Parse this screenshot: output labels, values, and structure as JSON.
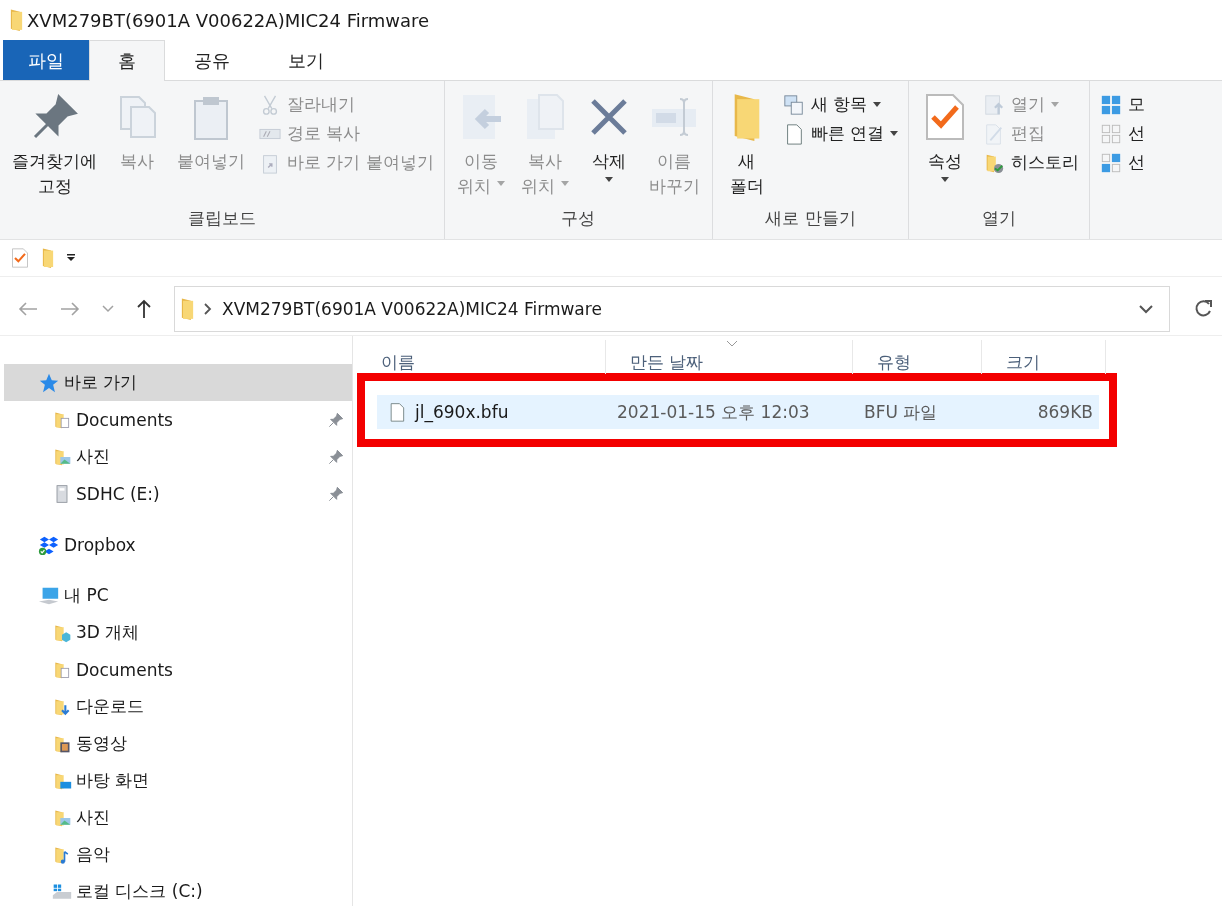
{
  "window": {
    "title": "XVM279BT(6901A V00622A)MIC24 Firmware"
  },
  "tabs": [
    {
      "label": "파일",
      "kind": "file",
      "selected": false
    },
    {
      "label": "홈",
      "kind": "tab",
      "selected": true
    },
    {
      "label": "공유",
      "kind": "tab",
      "selected": false
    },
    {
      "label": "보기",
      "kind": "tab",
      "selected": false
    }
  ],
  "ribbon": {
    "groups": [
      {
        "label": "클립보드",
        "items": [
          {
            "kind": "large",
            "lines": [
              "즐겨찾기에",
              "고정"
            ],
            "disabled": false,
            "dropdown": false
          },
          {
            "kind": "large",
            "lines": [
              "복사"
            ],
            "disabled": true,
            "dropdown": false
          },
          {
            "kind": "large",
            "lines": [
              "붙여넣기"
            ],
            "disabled": true,
            "dropdown": false
          },
          {
            "kind": "small",
            "lines": [
              "잘라내기"
            ],
            "disabled": true,
            "dropdown": false
          },
          {
            "kind": "small",
            "lines": [
              "경로 복사"
            ],
            "disabled": true,
            "dropdown": false
          },
          {
            "kind": "small",
            "lines": [
              "바로 가기 붙여넣기"
            ],
            "disabled": true,
            "dropdown": false
          }
        ]
      },
      {
        "label": "구성",
        "items": [
          {
            "kind": "large",
            "lines": [
              "이동",
              "위치"
            ],
            "disabled": true,
            "dropdown": true
          },
          {
            "kind": "large",
            "lines": [
              "복사",
              "위치"
            ],
            "disabled": true,
            "dropdown": true
          },
          {
            "kind": "large",
            "lines": [
              "삭제"
            ],
            "disabled": false,
            "dropdown": true
          },
          {
            "kind": "large",
            "lines": [
              "이름",
              "바꾸기"
            ],
            "disabled": true,
            "dropdown": false
          }
        ]
      },
      {
        "label": "새로 만들기",
        "items": [
          {
            "kind": "large",
            "lines": [
              "새",
              "폴더"
            ],
            "disabled": false,
            "dropdown": false
          },
          {
            "kind": "small",
            "lines": [
              "새 항목"
            ],
            "disabled": false,
            "dropdown": true
          },
          {
            "kind": "small",
            "lines": [
              "빠른 연결"
            ],
            "disabled": false,
            "dropdown": true
          }
        ]
      },
      {
        "label": "열기",
        "items": [
          {
            "kind": "large",
            "lines": [
              "속성"
            ],
            "disabled": false,
            "dropdown": true
          },
          {
            "kind": "small",
            "lines": [
              "열기"
            ],
            "disabled": true,
            "dropdown": true
          },
          {
            "kind": "small",
            "lines": [
              "편집"
            ],
            "disabled": true,
            "dropdown": false
          },
          {
            "kind": "small",
            "lines": [
              "히스토리"
            ],
            "disabled": false,
            "dropdown": false
          }
        ]
      },
      {
        "items": [
          {
            "kind": "small",
            "lines": [
              "모"
            ],
            "disabled": false,
            "dropdown": false
          },
          {
            "kind": "small",
            "lines": [
              "선"
            ],
            "disabled": false,
            "dropdown": false
          },
          {
            "kind": "small",
            "lines": [
              "선"
            ],
            "disabled": false,
            "dropdown": false
          }
        ]
      }
    ]
  },
  "address": {
    "back_disabled": true,
    "forward_disabled": true,
    "path": "XVM279BT(6901A V00622A)MIC24 Firmware"
  },
  "navigation": [
    {
      "label": "바로 가기",
      "selected": true,
      "children": [
        {
          "label": "Documents",
          "selected": false,
          "pinned": true
        },
        {
          "label": "사진",
          "selected": false,
          "pinned": true
        },
        {
          "label": "SDHC (E:)",
          "selected": false,
          "pinned": true
        }
      ]
    },
    {
      "label": "Dropbox",
      "selected": false
    },
    {
      "label": "내 PC",
      "selected": false,
      "children": [
        {
          "label": "3D 개체",
          "selected": false,
          "pinned": false
        },
        {
          "label": "Documents",
          "selected": false,
          "pinned": false
        },
        {
          "label": "다운로드",
          "selected": false,
          "pinned": false
        },
        {
          "label": "동영상",
          "selected": false,
          "pinned": false
        },
        {
          "label": "바탕 화면",
          "selected": false,
          "pinned": false
        },
        {
          "label": "사진",
          "selected": false,
          "pinned": false
        },
        {
          "label": "음악",
          "selected": false,
          "pinned": false
        },
        {
          "label": "로컬 디스크 (C:)",
          "selected": false,
          "pinned": false
        }
      ]
    }
  ],
  "files": {
    "columns": [
      {
        "label": "이름",
        "sorted": false
      },
      {
        "label": "만든 날짜",
        "sorted": true
      },
      {
        "label": "유형",
        "sorted": false
      },
      {
        "label": "크기",
        "sorted": false
      }
    ],
    "rows": [
      {
        "name": "jl_690x.bfu",
        "date": "2021-01-15 오후 12:03",
        "type": "BFU 파일",
        "size": "869KB",
        "selected": true,
        "framed": true
      }
    ]
  }
}
